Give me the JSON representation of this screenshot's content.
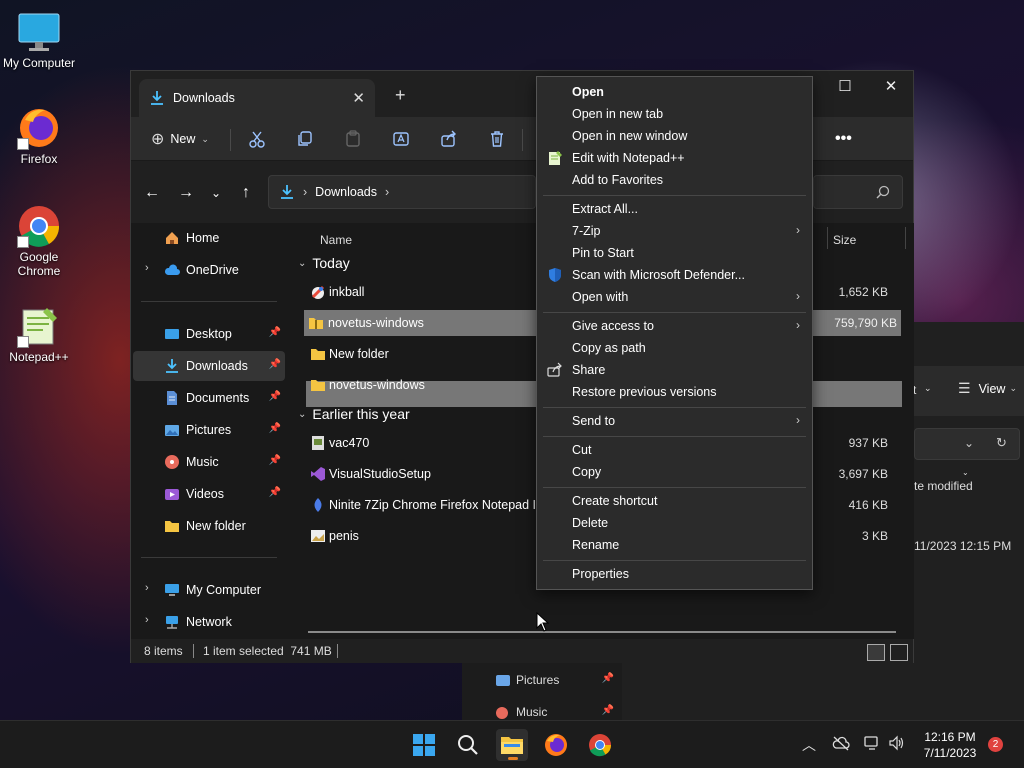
{
  "desktop": {
    "icons": [
      {
        "label": "My Computer"
      },
      {
        "label": "Firefox"
      },
      {
        "label": "Google Chrome"
      },
      {
        "label": "Notepad++"
      }
    ]
  },
  "background_window": {
    "toolbar_partial": "t",
    "view_label": "View",
    "column_partial": "te modified",
    "date_partial": "11/2023 12:15 PM",
    "sidebar": [
      {
        "label": "Pictures"
      },
      {
        "label": "Music"
      }
    ]
  },
  "explorer": {
    "tab_title": "Downloads",
    "new_label": "New",
    "address": {
      "segment": "Downloads"
    },
    "sidebar": [
      {
        "label": "Home"
      },
      {
        "label": "OneDrive"
      },
      {
        "label": "Desktop"
      },
      {
        "label": "Downloads"
      },
      {
        "label": "Documents"
      },
      {
        "label": "Pictures"
      },
      {
        "label": "Music"
      },
      {
        "label": "Videos"
      },
      {
        "label": "New folder"
      },
      {
        "label": "My Computer"
      },
      {
        "label": "Network"
      }
    ],
    "columns": {
      "name": "Name",
      "size": "Size"
    },
    "groups": [
      {
        "label": "Today"
      },
      {
        "label": "Earlier this year"
      }
    ],
    "files": [
      {
        "name": "inkball",
        "size": "1,652 KB"
      },
      {
        "name": "novetus-windows",
        "size": "759,790 KB"
      },
      {
        "name": "New folder",
        "size": ""
      },
      {
        "name": "novetus-windows",
        "size": ""
      },
      {
        "name": "vac470",
        "size": "937 KB"
      },
      {
        "name": "VisualStudioSetup",
        "size": "3,697 KB"
      },
      {
        "name": "Ninite 7Zip Chrome Firefox Notepad Installer",
        "size": "416 KB"
      },
      {
        "name": "penis",
        "size": "3 KB"
      }
    ],
    "status": {
      "items": "8 items",
      "selected": "1 item selected  741 MB"
    }
  },
  "context_menu": {
    "items": [
      {
        "label": "Open"
      },
      {
        "label": "Open in new tab"
      },
      {
        "label": "Open in new window"
      },
      {
        "label": "Edit with Notepad++"
      },
      {
        "label": "Add to Favorites"
      },
      {
        "label": "Extract All..."
      },
      {
        "label": "7-Zip"
      },
      {
        "label": "Pin to Start"
      },
      {
        "label": "Scan with Microsoft Defender..."
      },
      {
        "label": "Open with"
      },
      {
        "label": "Give access to"
      },
      {
        "label": "Copy as path"
      },
      {
        "label": "Share"
      },
      {
        "label": "Restore previous versions"
      },
      {
        "label": "Send to"
      },
      {
        "label": "Cut"
      },
      {
        "label": "Copy"
      },
      {
        "label": "Create shortcut"
      },
      {
        "label": "Delete"
      },
      {
        "label": "Rename"
      },
      {
        "label": "Properties"
      }
    ]
  },
  "taskbar": {
    "time": "12:16 PM",
    "date": "7/11/2023",
    "notifications": "2"
  },
  "colors": {
    "accent": "#4cc2ff",
    "selection": "#777777",
    "menu_bg": "#2b2b2b",
    "folder": "#f5c542"
  }
}
